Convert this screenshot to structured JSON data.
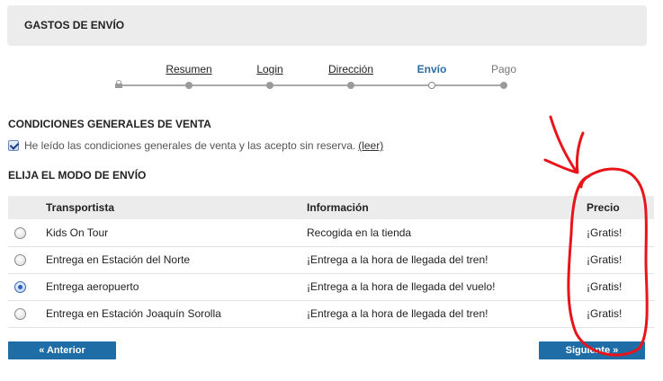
{
  "header": {
    "title": "GASTOS DE ENVÍO"
  },
  "steps": [
    {
      "label": "Resumen",
      "state": "done"
    },
    {
      "label": "Login",
      "state": "done"
    },
    {
      "label": "Dirección",
      "state": "done"
    },
    {
      "label": "Envío",
      "state": "current"
    },
    {
      "label": "Pago",
      "state": "future"
    }
  ],
  "conditions": {
    "title": "CONDICIONES GENERALES DE VENTA",
    "agree_text": "He leído las condiciones generales de venta y las acepto sin reserva.",
    "agree_link": "(leer)",
    "checked": true
  },
  "shipping": {
    "title": "ELIJA EL MODO DE ENVÍO",
    "headers": {
      "carrier": "Transportista",
      "info": "Información",
      "price": "Precio"
    },
    "rows": [
      {
        "name": "Kids On Tour",
        "info": "Recogida en la tienda",
        "price": "¡Gratis!",
        "selected": false
      },
      {
        "name": "Entrega en Estación del Norte",
        "info": "¡Entrega a la hora de llegada del tren!",
        "price": "¡Gratis!",
        "selected": false
      },
      {
        "name": "Entrega aeropuerto",
        "info": "¡Entrega a la hora de llegada del vuelo!",
        "price": "¡Gratis!",
        "selected": true
      },
      {
        "name": "Entrega en Estación Joaquín Sorolla",
        "info": "¡Entrega a la hora de llegada del tren!",
        "price": "¡Gratis!",
        "selected": false
      }
    ]
  },
  "buttons": {
    "prev": "« Anterior",
    "next": "Siguiente »"
  },
  "colors": {
    "accent": "#1f6da6",
    "current_step": "#2a6ca6",
    "annotation": "#e8141a"
  }
}
